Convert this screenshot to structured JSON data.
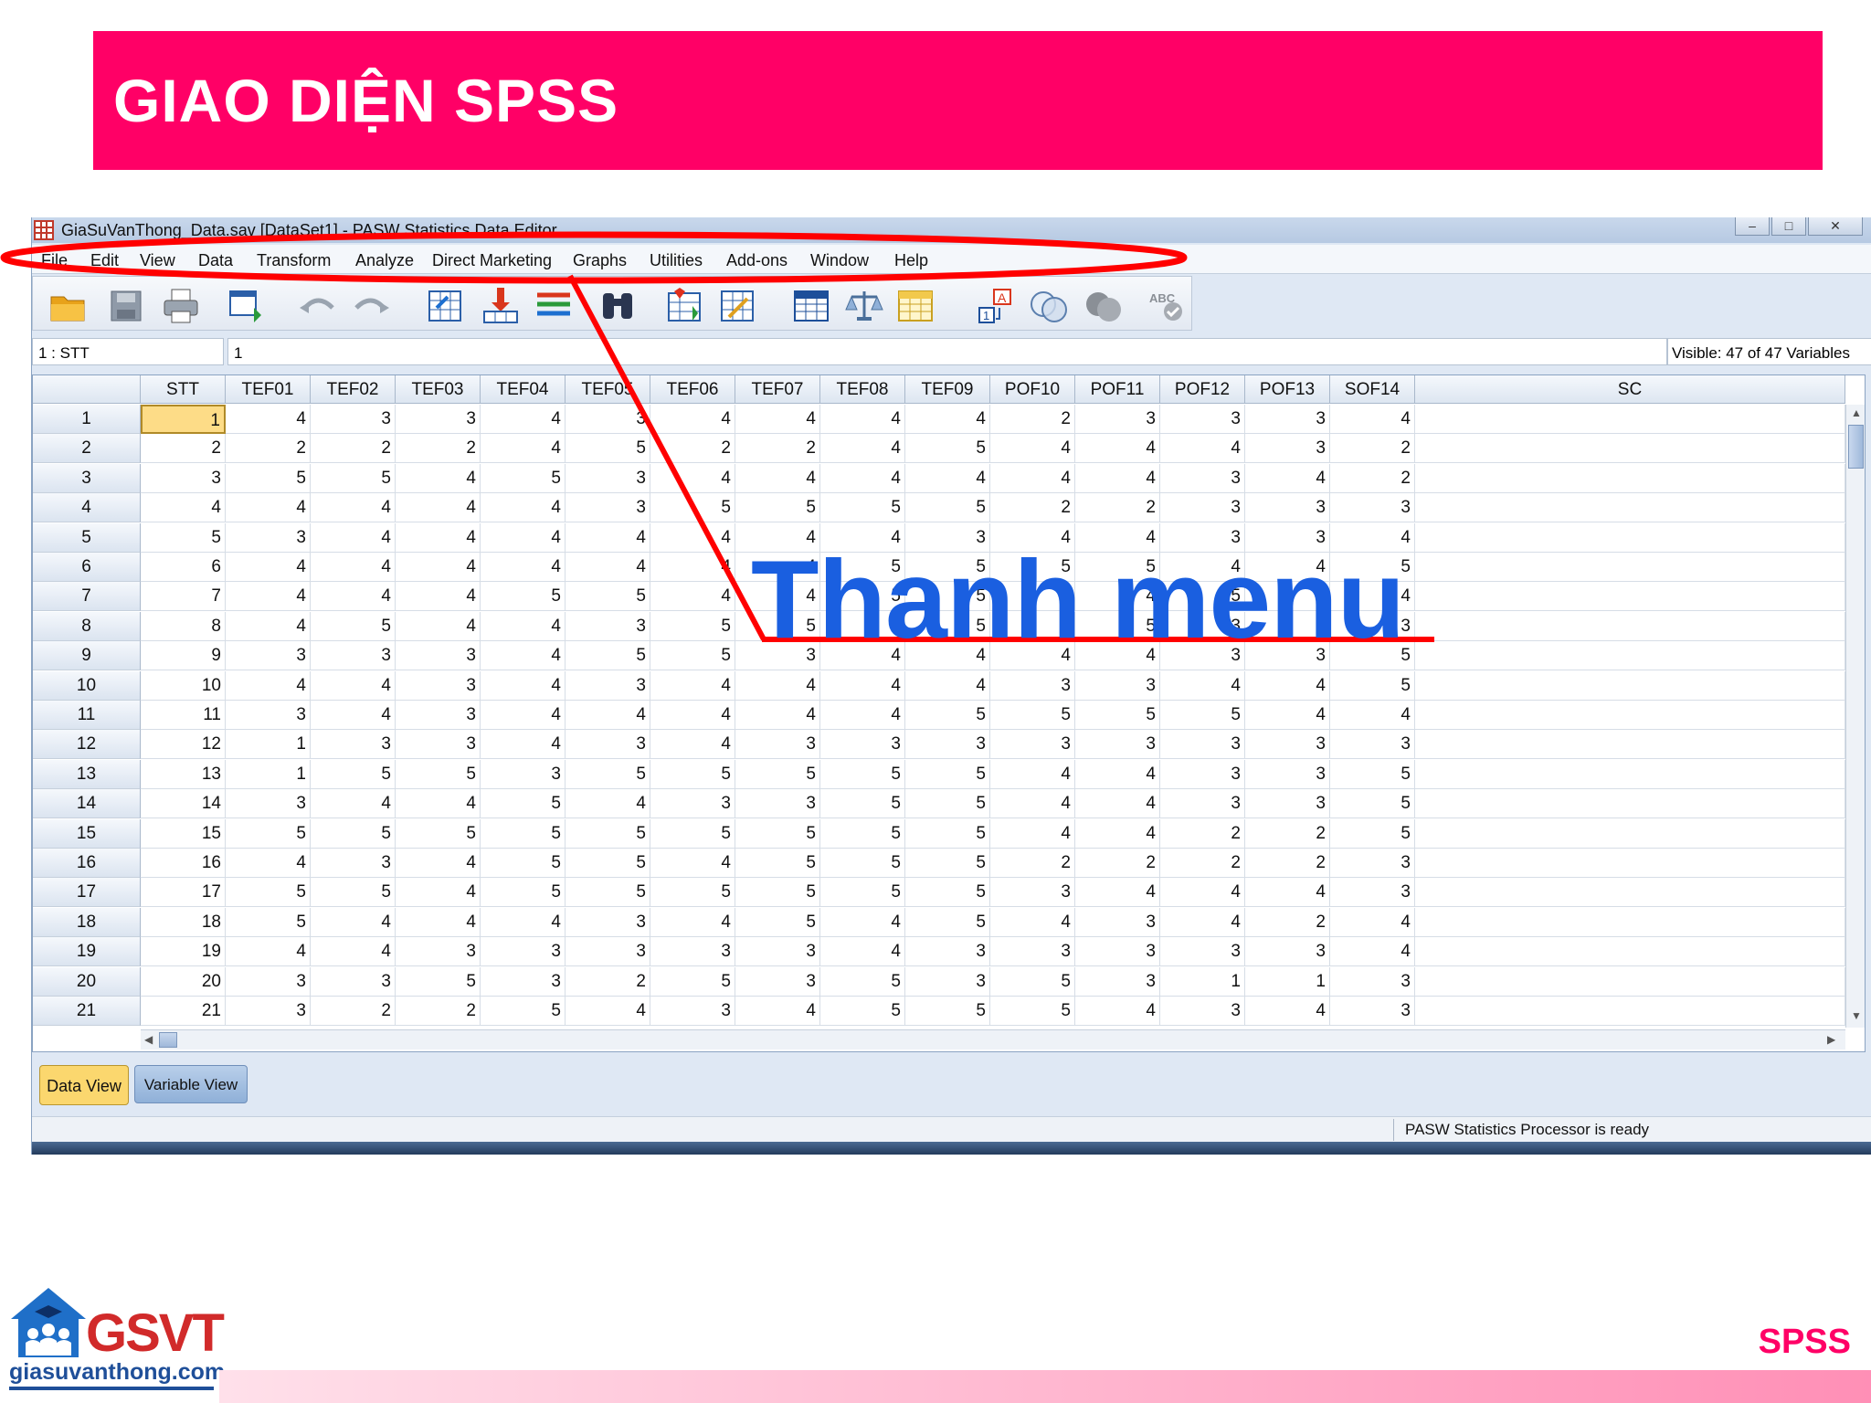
{
  "slide": {
    "title": "GIAO DIỆN SPSS",
    "footer_label": "SPSS"
  },
  "window": {
    "title": "GiaSuVanThong_Data.sav [DataSet1] - PASW Statistics Data Editor",
    "controls": [
      "–",
      "□",
      "✕"
    ]
  },
  "menu": [
    "File",
    "Edit",
    "View",
    "Data",
    "Transform",
    "Analyze",
    "Direct Marketing",
    "Graphs",
    "Utilities",
    "Add-ons",
    "Window",
    "Help"
  ],
  "toolbar": {
    "icons": [
      "open-folder-icon",
      "save-icon",
      "print-icon",
      "dialog-recall-icon",
      "undo-icon",
      "redo-icon",
      "goto-case-icon",
      "goto-variable-icon",
      "variables-icon",
      "find-icon",
      "insert-cases-icon",
      "insert-variable-icon",
      "split-file-icon",
      "weight-cases-icon",
      "select-cases-icon",
      "value-labels-icon",
      "use-variable-sets-icon",
      "show-all-variables-icon",
      "spell-check-icon"
    ]
  },
  "cellbar": {
    "ref": "1 : STT",
    "value": "1",
    "visible": "Visible: 47 of 47 Variables"
  },
  "grid": {
    "columns": [
      "STT",
      "TEF01",
      "TEF02",
      "TEF03",
      "TEF04",
      "TEF05",
      "TEF06",
      "TEF07",
      "TEF08",
      "TEF09",
      "POF10",
      "POF11",
      "POF12",
      "POF13",
      "SOF14",
      "SC"
    ],
    "rows": [
      [
        "1",
        "4",
        "3",
        "3",
        "4",
        "3",
        "4",
        "4",
        "4",
        "4",
        "2",
        "3",
        "3",
        "3",
        "4"
      ],
      [
        "2",
        "2",
        "2",
        "2",
        "4",
        "5",
        "2",
        "2",
        "4",
        "5",
        "4",
        "4",
        "4",
        "3",
        "2"
      ],
      [
        "3",
        "5",
        "5",
        "4",
        "5",
        "3",
        "4",
        "4",
        "4",
        "4",
        "4",
        "4",
        "3",
        "4",
        "2"
      ],
      [
        "4",
        "4",
        "4",
        "4",
        "4",
        "3",
        "5",
        "5",
        "5",
        "5",
        "2",
        "2",
        "3",
        "3",
        "3"
      ],
      [
        "5",
        "3",
        "4",
        "4",
        "4",
        "4",
        "4",
        "4",
        "4",
        "3",
        "4",
        "4",
        "3",
        "3",
        "4"
      ],
      [
        "6",
        "4",
        "4",
        "4",
        "4",
        "4",
        "4",
        "4",
        "5",
        "5",
        "5",
        "5",
        "4",
        "4",
        "5"
      ],
      [
        "7",
        "4",
        "4",
        "4",
        "5",
        "5",
        "4",
        "4",
        "5",
        "5",
        "4",
        "4",
        "5",
        "5",
        "4"
      ],
      [
        "8",
        "4",
        "5",
        "4",
        "4",
        "3",
        "5",
        "5",
        "5",
        "5",
        "4",
        "5",
        "3",
        "3",
        "3"
      ],
      [
        "9",
        "3",
        "3",
        "3",
        "4",
        "5",
        "5",
        "3",
        "4",
        "4",
        "4",
        "4",
        "3",
        "3",
        "5"
      ],
      [
        "10",
        "4",
        "4",
        "3",
        "4",
        "3",
        "4",
        "4",
        "4",
        "4",
        "3",
        "3",
        "4",
        "4",
        "5"
      ],
      [
        "11",
        "3",
        "4",
        "3",
        "4",
        "4",
        "4",
        "4",
        "4",
        "5",
        "5",
        "5",
        "5",
        "4",
        "4"
      ],
      [
        "12",
        "1",
        "3",
        "3",
        "4",
        "3",
        "4",
        "3",
        "3",
        "3",
        "3",
        "3",
        "3",
        "3",
        "3"
      ],
      [
        "13",
        "1",
        "5",
        "5",
        "3",
        "5",
        "5",
        "5",
        "5",
        "5",
        "4",
        "4",
        "3",
        "3",
        "5"
      ],
      [
        "14",
        "3",
        "4",
        "4",
        "5",
        "4",
        "3",
        "3",
        "5",
        "5",
        "4",
        "4",
        "3",
        "3",
        "5"
      ],
      [
        "15",
        "5",
        "5",
        "5",
        "5",
        "5",
        "5",
        "5",
        "5",
        "5",
        "4",
        "4",
        "2",
        "2",
        "5"
      ],
      [
        "16",
        "4",
        "3",
        "4",
        "5",
        "5",
        "4",
        "5",
        "5",
        "5",
        "2",
        "2",
        "2",
        "2",
        "3"
      ],
      [
        "17",
        "5",
        "5",
        "4",
        "5",
        "5",
        "5",
        "5",
        "5",
        "5",
        "3",
        "4",
        "4",
        "4",
        "3"
      ],
      [
        "18",
        "5",
        "4",
        "4",
        "4",
        "3",
        "4",
        "5",
        "4",
        "5",
        "4",
        "3",
        "4",
        "2",
        "4"
      ],
      [
        "19",
        "4",
        "4",
        "3",
        "3",
        "3",
        "3",
        "3",
        "4",
        "3",
        "3",
        "3",
        "3",
        "3",
        "4"
      ],
      [
        "20",
        "3",
        "3",
        "5",
        "3",
        "2",
        "5",
        "3",
        "5",
        "3",
        "5",
        "3",
        "1",
        "1",
        "3"
      ],
      [
        "21",
        "3",
        "2",
        "2",
        "5",
        "4",
        "3",
        "4",
        "5",
        "5",
        "5",
        "4",
        "3",
        "4",
        "3"
      ]
    ]
  },
  "tabs": {
    "data_view": "Data View",
    "variable_view": "Variable View"
  },
  "status": "PASW Statistics Processor is ready",
  "annotation": {
    "callout": "Thanh menu",
    "color": "#ff0000"
  },
  "logo": {
    "brand": "GSVT",
    "site": "giasuvanthong.com"
  },
  "colors": {
    "banner": "#ff0066",
    "callout_text": "#1a5fe0",
    "selected_cell": "#fddc87"
  }
}
